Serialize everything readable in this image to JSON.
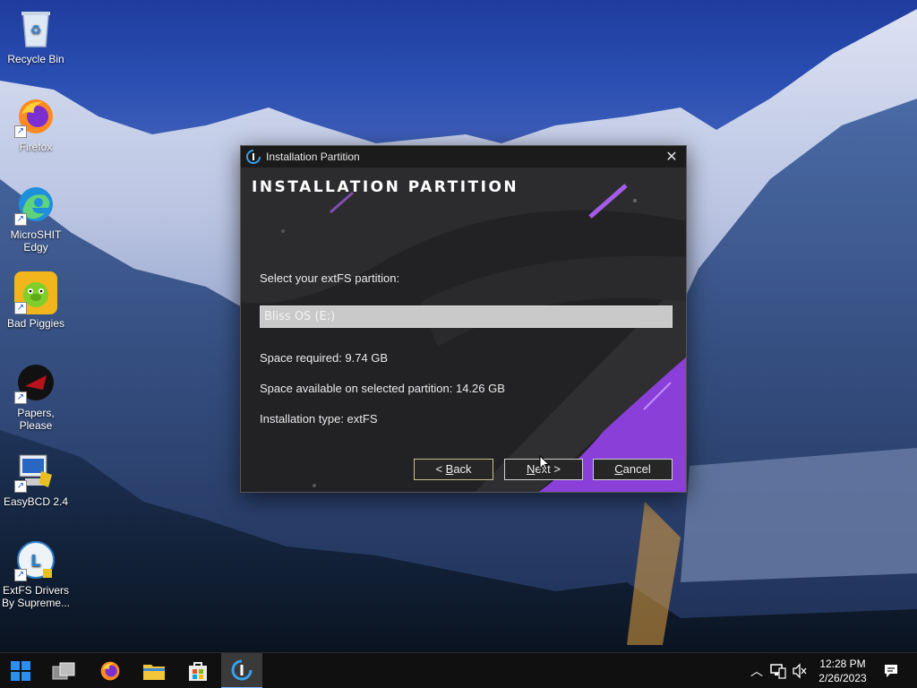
{
  "desktop": {
    "icons": [
      {
        "label": "Recycle Bin"
      },
      {
        "label": "Firefox"
      },
      {
        "label": "MicroSHIT Edgy"
      },
      {
        "label": "Bad Piggies"
      },
      {
        "label": "Papers, Please"
      },
      {
        "label": "EasyBCD 2.4"
      },
      {
        "label": "ExtFS Drivers By Supreme..."
      }
    ]
  },
  "dialog": {
    "title": "Installation Partition",
    "banner": "INSTALLATION PARTITION",
    "select_label": "Select your extFS partition:",
    "selected_partition": "Bliss OS (E:)",
    "space_required": "Space required: 9.74 GB",
    "space_available": "Space available on selected partition: 14.26 GB",
    "install_type": "Installation type: extFS",
    "buttons": {
      "back_prefix": "< ",
      "back_mnemonic": "B",
      "back_rest": "ack",
      "next_mnemonic": "N",
      "next_rest": "ext >",
      "cancel_mnemonic": "C",
      "cancel_rest": "ancel"
    },
    "accent_color": "#8a3fd8"
  },
  "taskbar": {
    "time": "12:28 PM",
    "date": "2/26/2023"
  }
}
